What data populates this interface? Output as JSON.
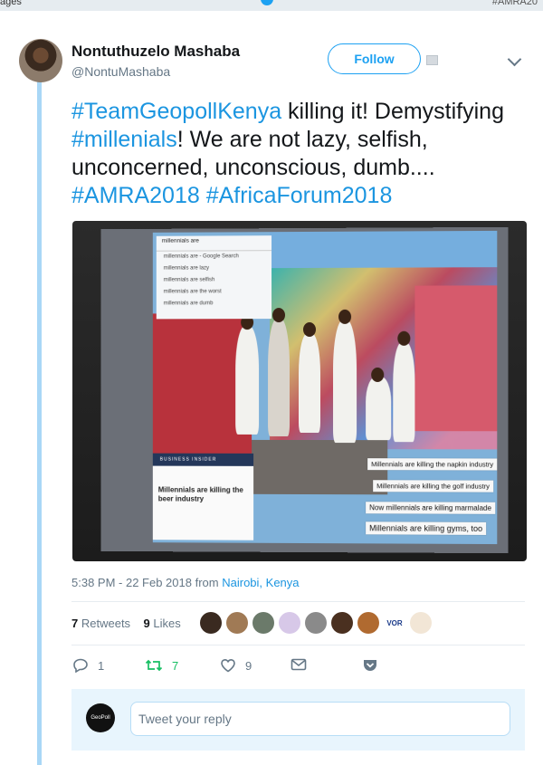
{
  "topbar": {
    "left_text": "ages",
    "right_text": "#AMRA20"
  },
  "header": {
    "name": "Nontuthuzelo Mashaba",
    "handle": "@NontuMashaba",
    "follow_label": "Follow"
  },
  "tweet": {
    "segments": [
      {
        "text": "#TeamGeopollKenya",
        "tag": true
      },
      {
        "text": " killing it! Demystifying ",
        "tag": false
      },
      {
        "text": "#millenials",
        "tag": true
      },
      {
        "text": "! We are not lazy, selfish, unconcerned, unconscious, dumb.... ",
        "tag": false
      },
      {
        "text": "#AMRA2018",
        "tag": true
      },
      {
        "text": " ",
        "tag": false
      },
      {
        "text": "#AfricaForum2018",
        "tag": true
      }
    ]
  },
  "photo": {
    "search": {
      "query": "millennials are",
      "suggestions": [
        "millennials are - Google Search",
        "millennials are lazy",
        "millennials are selfish",
        "millennials are the worst",
        "millennials are dumb"
      ]
    },
    "card": {
      "brand": "BUSINESS INSIDER",
      "headline": "Millennials are killing the beer industry"
    },
    "captions": [
      "Millennials are killing the napkin industry",
      "Millennials are killing the golf industry",
      "Now millennials are killing marmalade",
      "Millennials are killing gyms, too"
    ]
  },
  "meta": {
    "time": "5:38 PM - 22 Feb 2018",
    "from": "from",
    "location": "Nairobi, Kenya"
  },
  "stats": {
    "retweets_count": "7",
    "retweets_label": "Retweets",
    "likes_count": "9",
    "likes_label": "Likes"
  },
  "likers": [
    {
      "color": "#3a2a20"
    },
    {
      "color": "#a07a55"
    },
    {
      "color": "#6b7a6a"
    },
    {
      "color": "#d7c8e8"
    },
    {
      "color": "#8a8a8a"
    },
    {
      "color": "#4a3020"
    },
    {
      "color": "#b06a30"
    },
    {
      "color": "#ffffff",
      "text": "VOR"
    },
    {
      "color": "#f2e6d6"
    }
  ],
  "actions": {
    "reply_count": "1",
    "retweet_count": "7",
    "like_count": "9"
  },
  "reply": {
    "avatar_text": "GeoPoll",
    "placeholder": "Tweet your reply"
  },
  "colors": {
    "accent": "#1da1f2",
    "link": "#1b95e0",
    "retweet_green": "#17bf63"
  }
}
